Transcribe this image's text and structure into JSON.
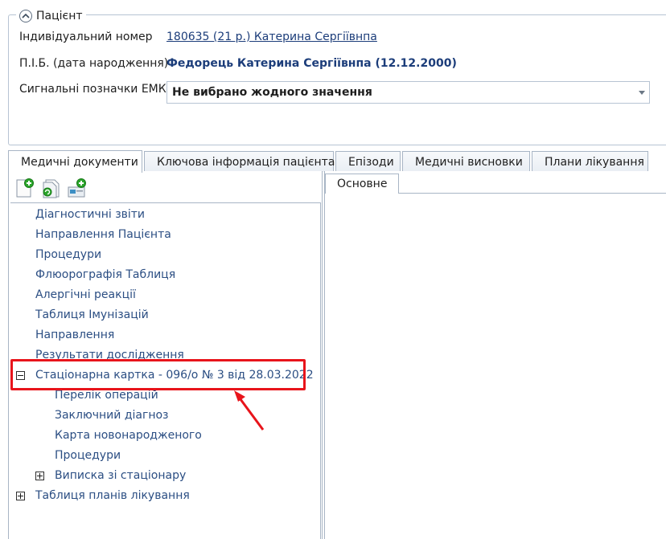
{
  "patient": {
    "group_title": "Пацієнт",
    "id_label": "Індивідуальний номер",
    "id_value": "180635 (21 р.) Катерина Сергіївнпа",
    "name_label": "П.І.Б. (дата народження)",
    "name_value": "Федорець Катерина Сергіївнпа (12.12.2000)",
    "signal_label": "Сигнальні позначки ЕМК",
    "signal_value": "Не вибрано жодного значення"
  },
  "tabs": [
    {
      "label": "Медичні документи",
      "active": true
    },
    {
      "label": "Ключова інформація пацієнта",
      "active": false
    },
    {
      "label": "Епізоди",
      "active": false
    },
    {
      "label": "Медичні висновки",
      "active": false
    },
    {
      "label": "Плани лікування",
      "active": false
    }
  ],
  "toolbar": {
    "icons": [
      "new-document-icon",
      "refresh-document-icon",
      "add-record-icon"
    ]
  },
  "tree": {
    "items": [
      {
        "label": "Діагностичні звіти"
      },
      {
        "label": "Направлення Пацієнта"
      },
      {
        "label": "Процедури"
      },
      {
        "label": "Флюорографія Таблиця"
      },
      {
        "label": "Алергічні реакції"
      },
      {
        "label": "Таблиця Імунізацій"
      },
      {
        "label": "Направлення"
      },
      {
        "label": "Результати дослідження"
      },
      {
        "label": "Стаціонарна картка - 096/о № 3 від 28.03.2022",
        "expanded": true
      },
      {
        "label": "Перелік операцій"
      },
      {
        "label": "Заключний діагноз"
      },
      {
        "label": "Карта новонародженого"
      },
      {
        "label": "Процедури"
      },
      {
        "label": "Виписка зі стаціонару",
        "expanded": false
      },
      {
        "label": "Таблиця планів лікування",
        "expanded": false
      }
    ]
  },
  "right_panel": {
    "subtab": "Основне"
  },
  "colors": {
    "highlight": "#e8141b",
    "link": "#1c3d7a",
    "tree_text": "#2b4e83",
    "border": "#a8b5c5"
  }
}
